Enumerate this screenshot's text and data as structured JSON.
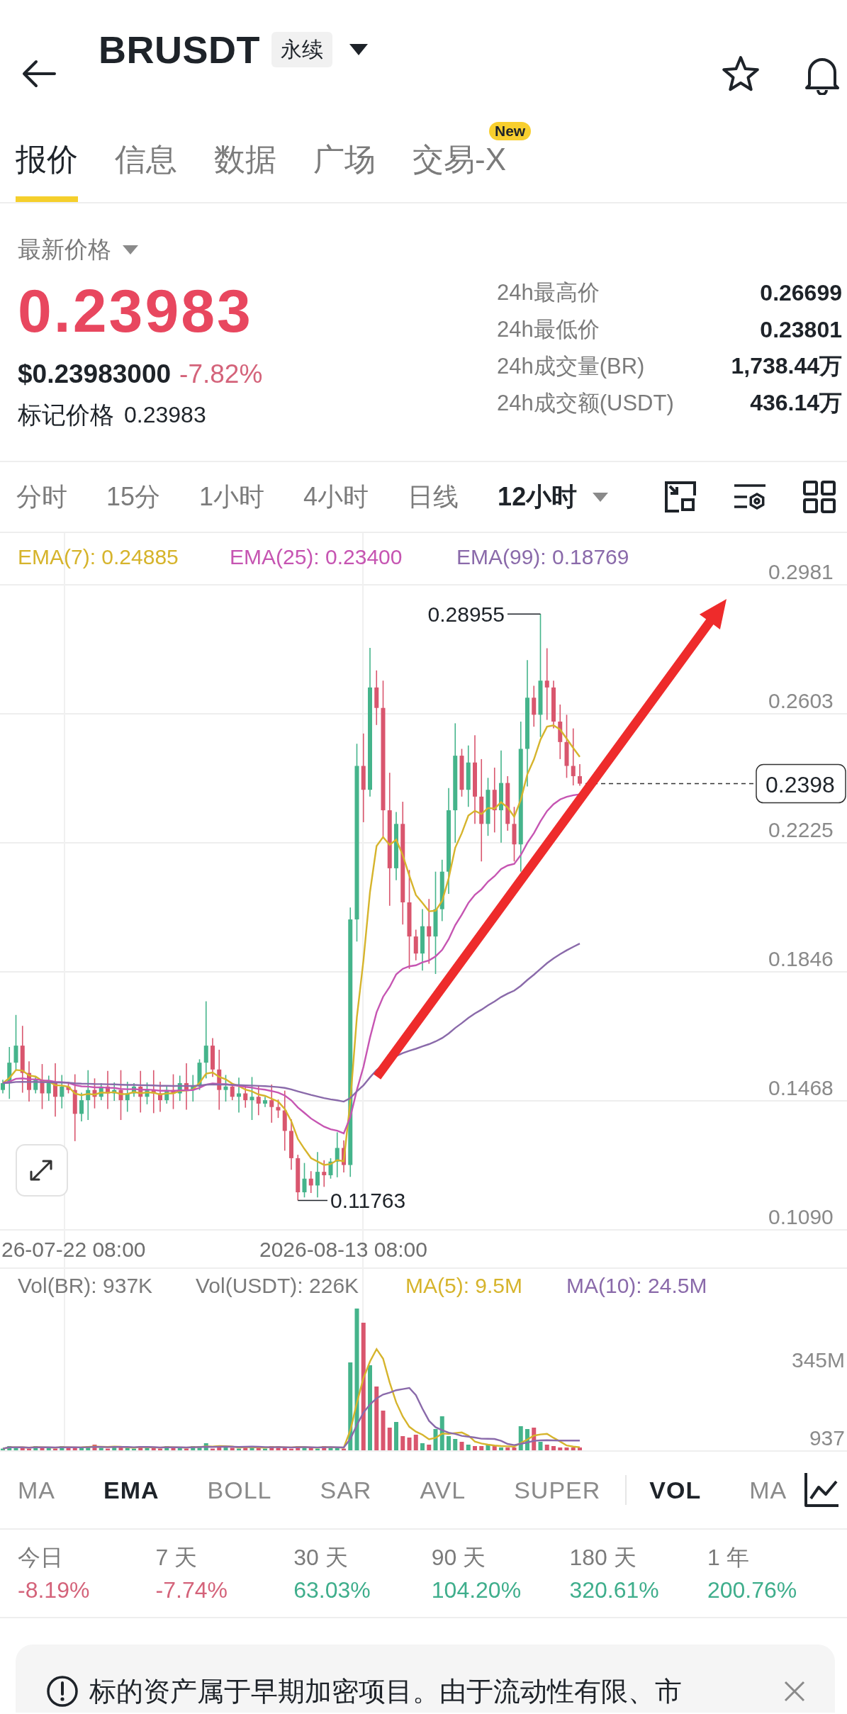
{
  "header": {
    "title": "BRUSDT",
    "badge": "永续"
  },
  "tabs": [
    {
      "label": "报价",
      "selected": true
    },
    {
      "label": "信息",
      "selected": false
    },
    {
      "label": "数据",
      "selected": false
    },
    {
      "label": "广场",
      "selected": false
    },
    {
      "label": "交易-X",
      "selected": false,
      "badge": "New"
    }
  ],
  "price": {
    "label": "最新价格",
    "last": "0.23983",
    "usd": "$0.23983000",
    "change": "-7.82%",
    "falling": true,
    "mark_label": "标记价格",
    "mark": "0.23983"
  },
  "stats": [
    {
      "label": "24h最高价",
      "value": "0.26699"
    },
    {
      "label": "24h最低价",
      "value": "0.23801"
    },
    {
      "label": "24h成交量(BR)",
      "value": "1,738.44万"
    },
    {
      "label": "24h成交额(USDT)",
      "value": "436.14万"
    }
  ],
  "intervals": [
    {
      "label": "分时",
      "selected": false,
      "dropdown": false
    },
    {
      "label": "15分",
      "selected": false,
      "dropdown": false
    },
    {
      "label": "1小时",
      "selected": false,
      "dropdown": false
    },
    {
      "label": "4小时",
      "selected": false,
      "dropdown": false
    },
    {
      "label": "日线",
      "selected": false,
      "dropdown": false
    },
    {
      "label": "12小时",
      "selected": true,
      "dropdown": true
    }
  ],
  "chart": {
    "legend": [
      {
        "label": "EMA(7): 0.24885",
        "color": "#d6b42c"
      },
      {
        "label": "EMA(25): 0.23400",
        "color": "#c655b2"
      },
      {
        "label": "EMA(99): 0.18769",
        "color": "#8a6aaa"
      }
    ],
    "y_labels": [
      "0.2981",
      "0.2603",
      "0.2225",
      "0.1846",
      "0.1468",
      "0.1090"
    ],
    "x_labels": [
      "26-07-22 08:00",
      "2026-08-13 08:00"
    ],
    "high_label": "0.28955",
    "low_label": "0.11763",
    "price_tag": "0.2398"
  },
  "volume": {
    "legend": [
      {
        "label": "Vol(BR): 937K",
        "color": "#7a7a7a"
      },
      {
        "label": "Vol(USDT): 226K",
        "color": "#7a7a7a"
      },
      {
        "label": "MA(5): 9.5M",
        "color": "#d6b42c"
      },
      {
        "label": "MA(10): 24.5M",
        "color": "#8a6aaa"
      }
    ],
    "y_labels": [
      "345M",
      "937"
    ]
  },
  "main_indicators": [
    {
      "label": "MA",
      "selected": false
    },
    {
      "label": "EMA",
      "selected": true
    },
    {
      "label": "BOLL",
      "selected": false
    },
    {
      "label": "SAR",
      "selected": false
    },
    {
      "label": "AVL",
      "selected": false
    },
    {
      "label": "SUPER",
      "selected": false
    }
  ],
  "sub_indicators": [
    {
      "label": "VOL",
      "selected": true
    },
    {
      "label": "MA",
      "selected": false
    }
  ],
  "returns": [
    {
      "period": "今日",
      "value": "-8.19%",
      "falling": true
    },
    {
      "period": "7 天",
      "value": "-7.74%",
      "falling": true
    },
    {
      "period": "30 天",
      "value": "63.03%",
      "falling": false
    },
    {
      "period": "90 天",
      "value": "104.20%",
      "falling": false
    },
    {
      "period": "180 天",
      "value": "320.61%",
      "falling": false
    },
    {
      "period": "1 年",
      "value": "200.76%",
      "falling": false
    }
  ],
  "notice": {
    "text": "标的资产属于早期加密项目。由于流动性有限、市"
  }
}
